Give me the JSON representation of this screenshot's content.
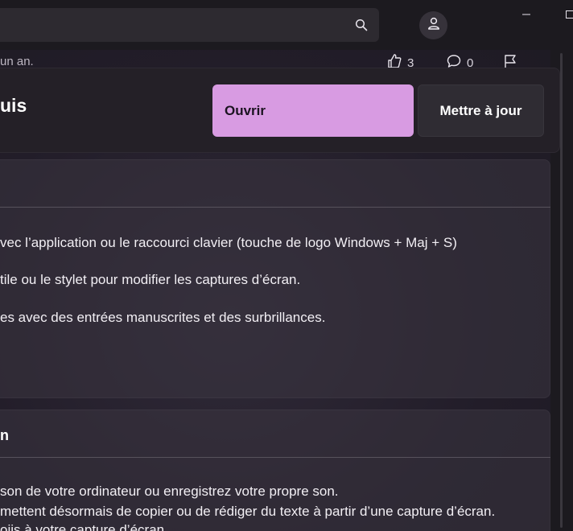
{
  "titlebar": {
    "search_icon": "search-icon",
    "account_icon": "person-icon",
    "minimize_icon": "minimize-icon",
    "maximize_icon": "maximize-icon"
  },
  "review_meta": {
    "time_ago": "un an.",
    "like_count": "3",
    "comment_count": "0",
    "icons": [
      "thumbs-up-icon",
      "comment-icon",
      "flag-icon"
    ]
  },
  "header": {
    "title": "uis",
    "open_label": "Ouvrir",
    "update_label": "Mettre à jour",
    "accent": "#d89be2"
  },
  "section1": {
    "heading": "",
    "lines": [
      "vec l’application ou le raccourci clavier (touche de logo Windows + Maj + S)",
      "tile ou le stylet pour modifier les captures d’écran.",
      "es avec des entrées manuscrites et des surbrillances."
    ]
  },
  "section2": {
    "heading": "n",
    "lines": [
      "son de votre ordinateur ou enregistrez votre propre son.",
      "mettent désormais de copier ou de rédiger du texte à partir d’une capture d’écran.",
      "oiis à votre capture d’écran"
    ]
  }
}
